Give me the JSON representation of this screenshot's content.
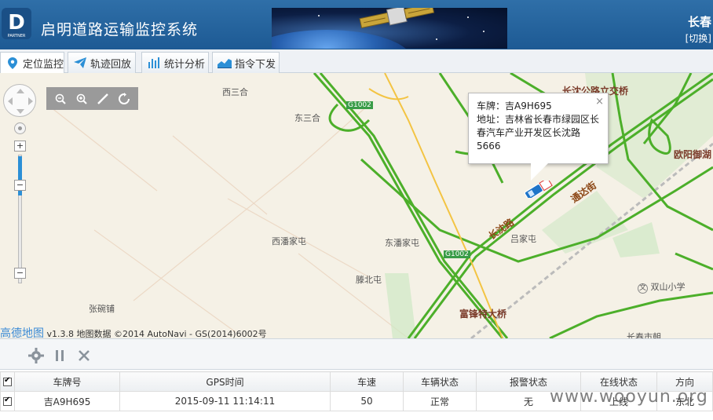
{
  "header": {
    "title": "启明道路运输监控系统",
    "city": "长春",
    "switch_label": "[切换]",
    "logo_text": "PARTNER"
  },
  "tabs": [
    {
      "label": "定位监控",
      "icon": "location-pin-icon",
      "active": true
    },
    {
      "label": "轨迹回放",
      "icon": "paper-plane-icon",
      "active": false
    },
    {
      "label": "统计分析",
      "icon": "bar-chart-icon",
      "active": false
    },
    {
      "label": "指令下发",
      "icon": "area-chart-icon",
      "active": false
    }
  ],
  "map": {
    "labels": {
      "xisanhe": "西三合",
      "dongsanhe": "东三合",
      "xipanjiatun": "西潘家屯",
      "dongpanjiatun": "东潘家屯",
      "tengbeitun": "滕北屯",
      "lvjiatun": "吕家屯",
      "zhangwanpu": "张碗铺",
      "fufengdaqiao": "富锋特大桥",
      "changshenqiao": "长沈公路立交桥",
      "ouyangyuhu": "欧阳御湖",
      "shuangshanxiaoxue": "双山小学",
      "changchunshi": "长春市朝",
      "changshenlu": "长沈路",
      "tongjinlu": "通达街",
      "g1002_top": "G1002",
      "g1002_mid": "G1002",
      "hw_changshen": "长沈"
    },
    "popup": {
      "plate": "车牌：吉A9H695",
      "address": "地址：吉林省长春市绿园区长春汽车产业开发区长沈路5666",
      "close": "×"
    },
    "copyright": {
      "brand": "高德地图",
      "text": "v1.3.8 地图数据 ©2014 AutoNavi - GS(2014)6002号"
    }
  },
  "table": {
    "headers": [
      "车牌号",
      "GPS时间",
      "车速",
      "车辆状态",
      "报警状态",
      "在线状态",
      "方向"
    ],
    "rows": [
      [
        "吉A9H695",
        "2015-09-11 11:14:11",
        "50",
        "正常",
        "无",
        "上线",
        "东北"
      ]
    ]
  },
  "watermark": "www.wooyun.org",
  "colors": {
    "header_bg": "#1d5a94",
    "road_green": "#4caf2a",
    "road_yellow": "#f3c443",
    "accent_blue": "#2b8fd6"
  }
}
